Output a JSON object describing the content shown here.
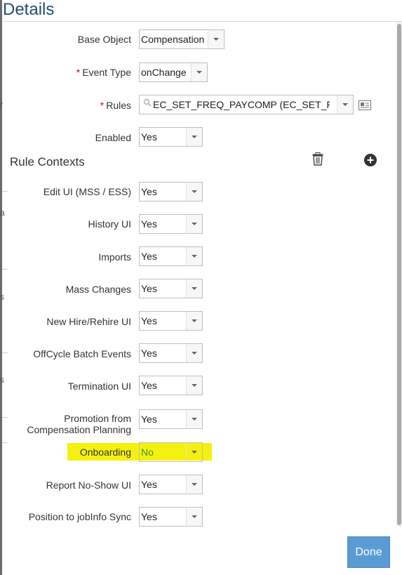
{
  "dialog": {
    "title": "Details",
    "done_label": "Done"
  },
  "fields": {
    "base_object": {
      "label": "Base Object",
      "value": "Compensation"
    },
    "event_type": {
      "label": "Event Type",
      "required_mark": "*",
      "value": "onChange"
    },
    "rules": {
      "label": "Rules",
      "required_mark": "*",
      "value": "EC_SET_FREQ_PAYCOMP (EC_SET_FR..."
    },
    "enabled": {
      "label": "Enabled",
      "value": "Yes"
    }
  },
  "rule_contexts": {
    "title": "Rule Contexts",
    "items": [
      {
        "label": "Edit UI (MSS / ESS)",
        "value": "Yes"
      },
      {
        "label": "History UI",
        "value": "Yes"
      },
      {
        "label": "Imports",
        "value": "Yes"
      },
      {
        "label": "Mass Changes",
        "value": "Yes"
      },
      {
        "label": "New Hire/Rehire UI",
        "value": "Yes"
      },
      {
        "label": "OffCycle Batch Events",
        "value": "Yes"
      },
      {
        "label": "Termination UI",
        "value": "Yes"
      },
      {
        "label_line1": "Promotion from",
        "label_line2": "Compensation Planning",
        "value": "Yes"
      },
      {
        "label": "Onboarding",
        "value": "No",
        "highlight_color": "#f5f10f",
        "value_color": "#3a9a2a"
      },
      {
        "label": "Report No-Show UI",
        "value": "Yes"
      },
      {
        "label": "Position to jobInfo Sync",
        "value": "Yes"
      }
    ]
  },
  "background_fragments": [
    "r",
    "a",
    "s",
    "s"
  ]
}
